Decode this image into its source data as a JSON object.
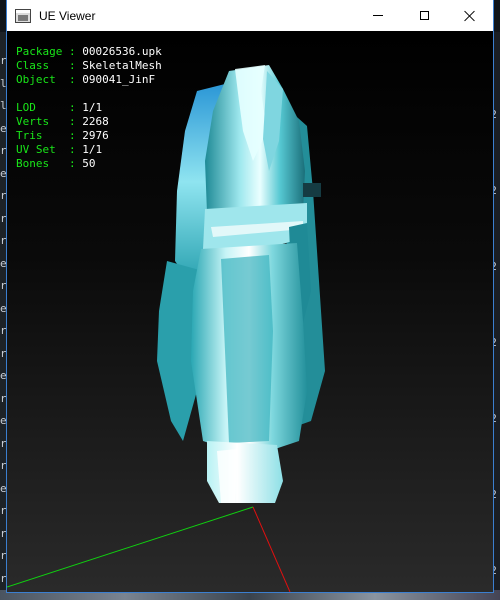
{
  "window": {
    "title": "UE Viewer",
    "controls": {
      "minimize": "minimize",
      "maximize": "maximize",
      "close": "close"
    }
  },
  "info": {
    "package_label": "Package",
    "package": "00026536.upk",
    "class_label": "Class",
    "class": "SkeletalMesh",
    "object_label": "Object",
    "object": "090041_JinF",
    "lod_label": "LOD",
    "lod": "1/1",
    "verts_label": "Verts",
    "verts": "2268",
    "tris_label": "Tris",
    "tris": "2976",
    "uvset_label": "UV Set",
    "uvset": "1/1",
    "bones_label": "Bones",
    "bones": "50"
  },
  "background": {
    "left_strip_chars": [
      "r",
      "l",
      "l",
      "e",
      "r",
      "e",
      "r",
      "r",
      "r",
      "e",
      "r",
      "e",
      "r",
      "r",
      "e",
      "r",
      "e",
      "r",
      "r",
      "e",
      "r",
      "r",
      "r",
      "r"
    ],
    "right_strip_chars": [
      "2",
      "2",
      "2",
      "2",
      "2",
      "2",
      "2"
    ]
  },
  "colors": {
    "info_label": "#19e619",
    "info_value": "#ffffff",
    "axis_x": "#e01010",
    "axis_y": "#10d010",
    "axis_z": "#2030ff",
    "mesh_base": "#3fb8c4",
    "mesh_highlight": "#e8ffff"
  }
}
